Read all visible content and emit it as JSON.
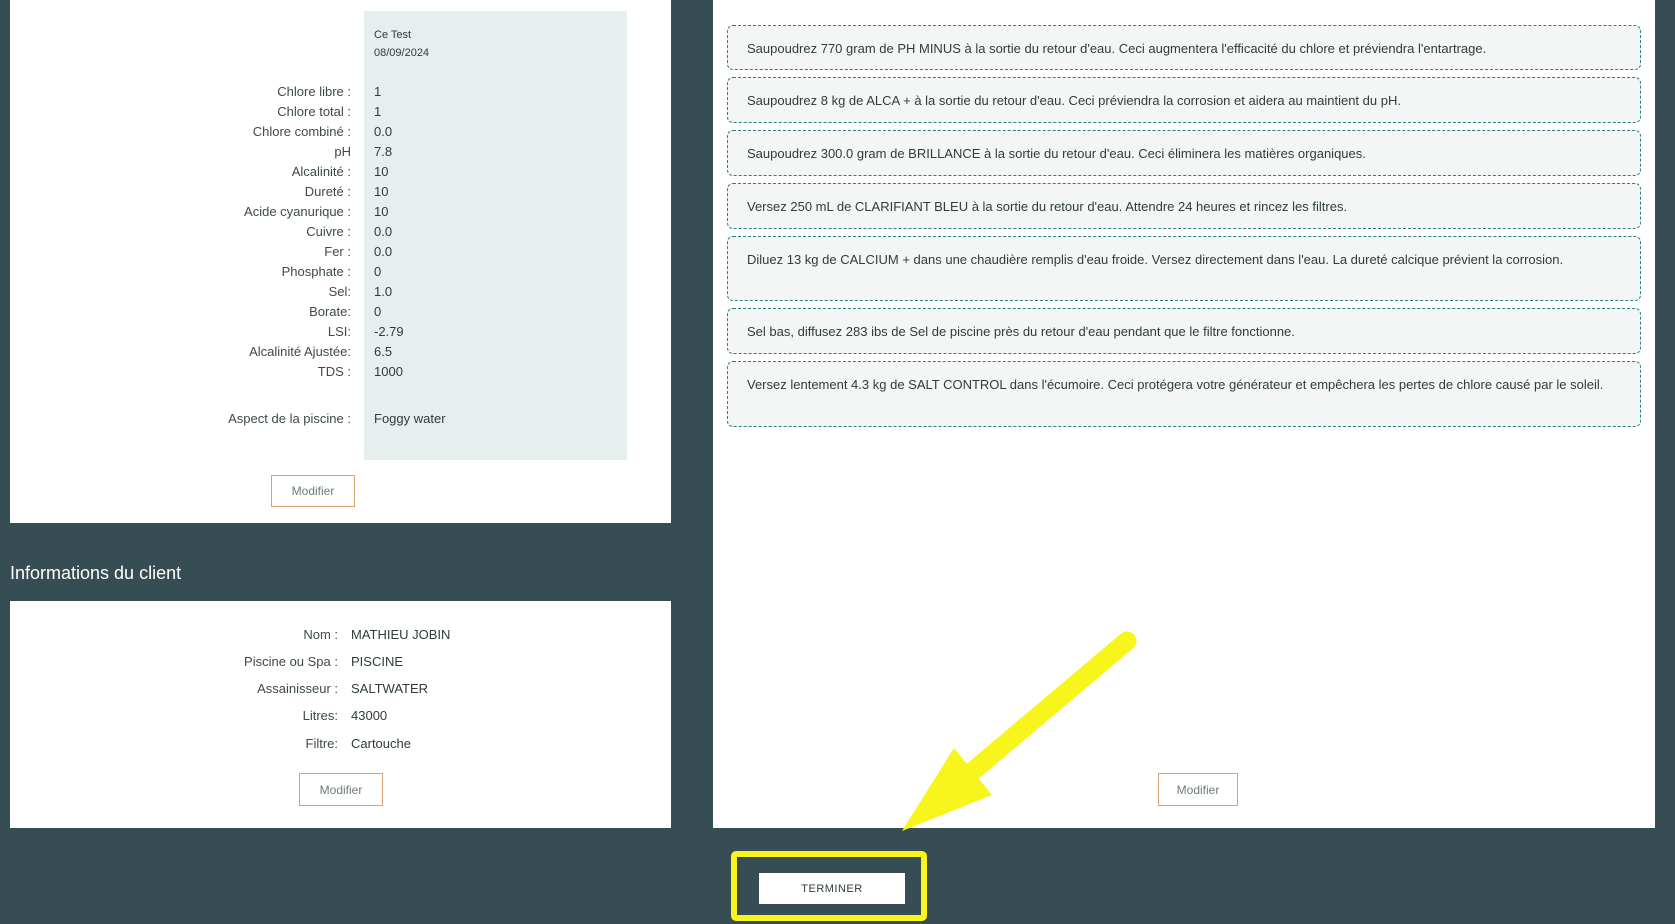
{
  "water_test": {
    "test_name": "Ce Test",
    "test_date": "08/09/2024",
    "rows": [
      {
        "label": "Chlore libre :",
        "value": "1"
      },
      {
        "label": "Chlore total :",
        "value": "1"
      },
      {
        "label": "Chlore combiné :",
        "value": "0.0"
      },
      {
        "label": "pH",
        "value": "7.8"
      },
      {
        "label": "Alcalinité :",
        "value": "10"
      },
      {
        "label": "Dureté :",
        "value": "10"
      },
      {
        "label": "Acide cyanurique :",
        "value": "10"
      },
      {
        "label": "Cuivre :",
        "value": "0.0"
      },
      {
        "label": "Fer :",
        "value": "0.0"
      },
      {
        "label": "Phosphate :",
        "value": "0"
      },
      {
        "label": "Sel:",
        "value": "1.0"
      },
      {
        "label": "Borate:",
        "value": "0"
      },
      {
        "label": "LSI:",
        "value": "-2.79"
      },
      {
        "label": "Alcalinité Ajustée:",
        "value": "6.5"
      },
      {
        "label": "TDS :",
        "value": "1000"
      }
    ],
    "aspect_label": "Aspect de la piscine :",
    "aspect_value": "Foggy water",
    "modify_label": "Modifier"
  },
  "client": {
    "section_title": "Informations du client",
    "rows": [
      {
        "label": "Nom :",
        "value": "MATHIEU JOBIN"
      },
      {
        "label": "Piscine ou Spa :",
        "value": "PISCINE"
      },
      {
        "label": "Assainisseur :",
        "value": "SALTWATER"
      },
      {
        "label": "Litres:",
        "value": "43000"
      },
      {
        "label": "Filtre:",
        "value": "Cartouche"
      }
    ],
    "modify_label": "Modifier"
  },
  "recommendations": {
    "items": [
      "Saupoudrez 770 gram de PH MINUS à la sortie du retour d'eau. Ceci augmentera l'efficacité du chlore et préviendra l'entartrage.",
      "Saupoudrez 8 kg de ALCA + à la sortie du retour d'eau. Ceci préviendra la corrosion et aidera au maintient du pH.",
      "Saupoudrez 300.0 gram de BRILLANCE à la sortie du retour d'eau. Ceci éliminera les matières organiques.",
      "Versez 250 mL de CLARIFIANT BLEU à la sortie du retour d'eau. Attendre 24 heures et rincez les filtres.",
      "Diluez 13 kg de CALCIUM + dans une chaudière remplis d'eau froide. Versez directement dans l'eau. La dureté calcique prévient la corrosion.",
      "Sel bas, diffusez 283 ibs de Sel de piscine près du retour d'eau pendant que le filtre fonctionne.",
      "Versez lentement 4.3 kg de SALT CONTROL dans l'écumoire. Ceci protégera votre générateur et empêchera les pertes de chlore causé par le soleil."
    ],
    "modify_label": "Modifier"
  },
  "footer": {
    "finish_label": "TERMINER"
  },
  "colors": {
    "background": "#354d53",
    "highlight": "#f7f51c",
    "button_border": "#d7a46d",
    "reco_border": "#2d7c86"
  }
}
